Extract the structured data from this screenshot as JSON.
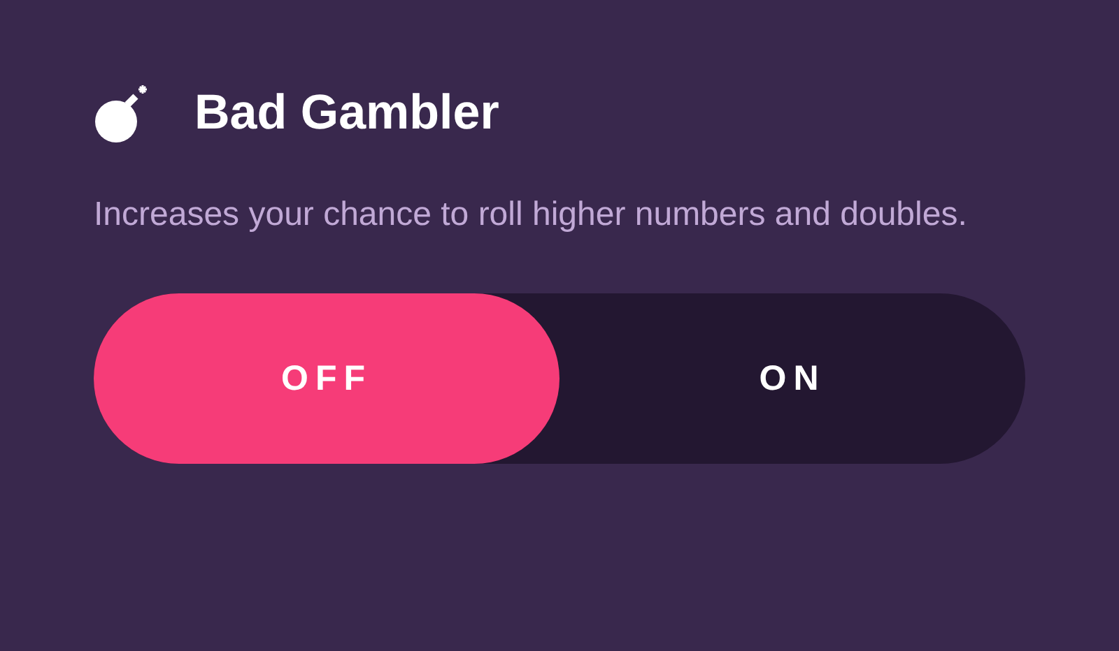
{
  "title": "Bad Gambler",
  "description": "Increases your chance to roll higher numbers and doubles.",
  "toggle": [
    {
      "label": "OFF",
      "selected": true
    },
    {
      "label": "ON",
      "selected": false
    }
  ]
}
